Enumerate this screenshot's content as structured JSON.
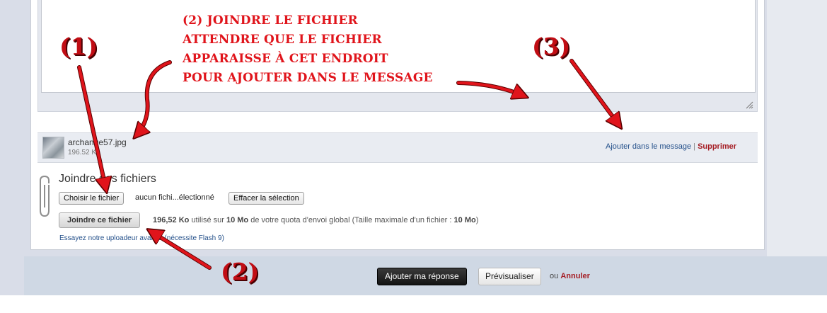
{
  "attachment": {
    "filename": "archange57.jpg",
    "size": "196.52 Ko",
    "insert_link": "Ajouter dans le message",
    "separator": "|",
    "delete_link": "Supprimer"
  },
  "upload": {
    "title": "Joindre des fichiers",
    "choose_button": "Choisir le fichier",
    "no_file_text": "aucun fichi...électionné",
    "clear_button": "Effacer la sélection",
    "upload_button": "Joindre ce fichier",
    "quota_used": "196,52 Ko",
    "quota_text_1": "utilisé sur",
    "quota_max": "10 Mo",
    "quota_text_2": "de votre quota d'envoi global (Taille maximale d'un fichier :",
    "max_file": "10 Mo",
    "quota_text_3": ")",
    "flash_text": "Essayez notre uploadeur avancé (nécessite Flash 9)"
  },
  "footer": {
    "submit_button": "Ajouter ma réponse",
    "preview_button": "Prévisualiser",
    "or_text": "ou",
    "cancel_link": "Annuler"
  },
  "annotations": {
    "step1": "(1)",
    "step2": "(2)",
    "step3": "(3)",
    "note_lines": [
      "(2) JOINDRE LE FICHIER",
      "ATTENDRE QUE LE FICHIER",
      "APPARAISSE À CET ENDROIT",
      "POUR AJOUTER DANS LE MESSAGE"
    ]
  },
  "colors": {
    "annotation_red": "#e0141b",
    "link_blue": "#24508a",
    "link_red": "#a51d24",
    "footer_bg": "#cfd8e4"
  },
  "icons": [
    "paperclip-icon",
    "resize-grip-icon",
    "image-thumbnail"
  ]
}
